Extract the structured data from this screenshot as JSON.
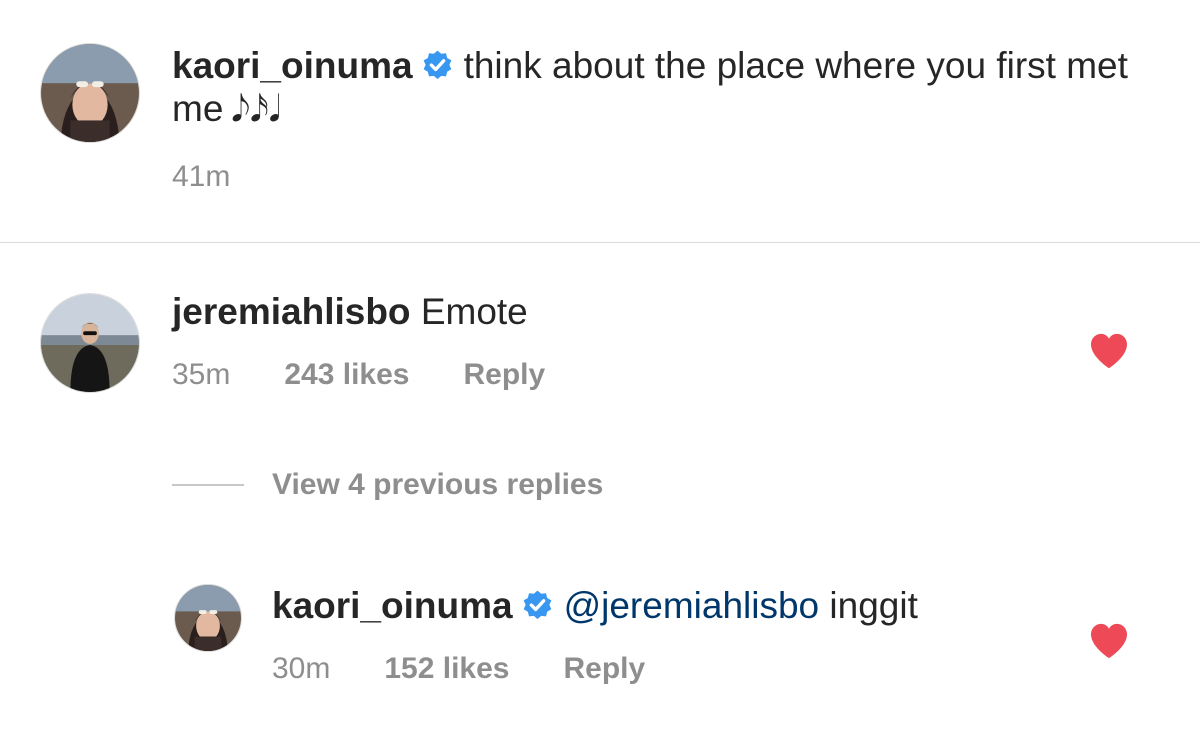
{
  "caption": {
    "username": "kaori_oinuma",
    "verified": true,
    "text": "think about the place where you first met me",
    "notes": "𝅘𝅥𝅮𝅘𝅥𝅯𝅘𝅥",
    "time": "41m"
  },
  "comment": {
    "username": "jeremiahlisbo",
    "text": "Emote",
    "time": "35m",
    "likes": "243 likes",
    "reply_label": "Reply",
    "liked": true
  },
  "view_replies_label": "View 4 previous replies",
  "reply": {
    "username": "kaori_oinuma",
    "verified": true,
    "mention": "@jeremiahlisbo",
    "text": "inggit",
    "time": "30m",
    "likes": "152 likes",
    "reply_label": "Reply",
    "liked": true
  },
  "colors": {
    "verified_badge": "#3897f0",
    "heart": "#ed4956",
    "mention": "#00376b",
    "meta_text": "#8e8e8e"
  }
}
